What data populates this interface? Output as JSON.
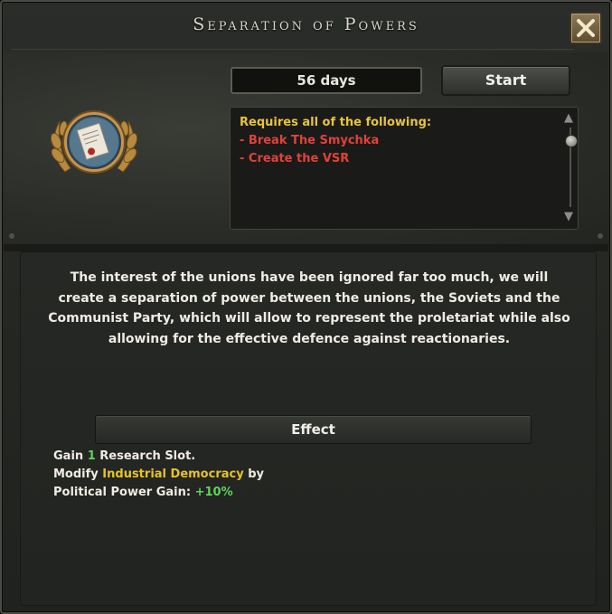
{
  "window": {
    "title": "Separation of Powers",
    "close_icon": "close-icon"
  },
  "decision": {
    "icon": "law-document-medal-icon",
    "duration": "56 days",
    "start_label": "Start",
    "requirements": {
      "title": "Requires all of the following:",
      "items": [
        "- Break The Smychka",
        "- Create the VSR"
      ]
    },
    "description": "The interest of the unions have been ignored far too much, we will create a separation of power between the unions, the Soviets and the Communist Party, which will allow to represent the proletariat while also allowing for the effective defence against reactionaries."
  },
  "effect": {
    "header": "Effect",
    "line1": {
      "prefix": "Gain ",
      "value": "1",
      "suffix": " Research Slot."
    },
    "line2": {
      "prefix": "Modify ",
      "name": "Industrial Democracy",
      "suffix": " by"
    },
    "line3": {
      "prefix": "Political Power Gain: ",
      "value": "+10%"
    }
  },
  "colors": {
    "requirement_title": "#e8c33c",
    "requirement_item": "#e0423a",
    "positive_value": "#5fd35a",
    "highlight_name": "#e6c22a"
  }
}
